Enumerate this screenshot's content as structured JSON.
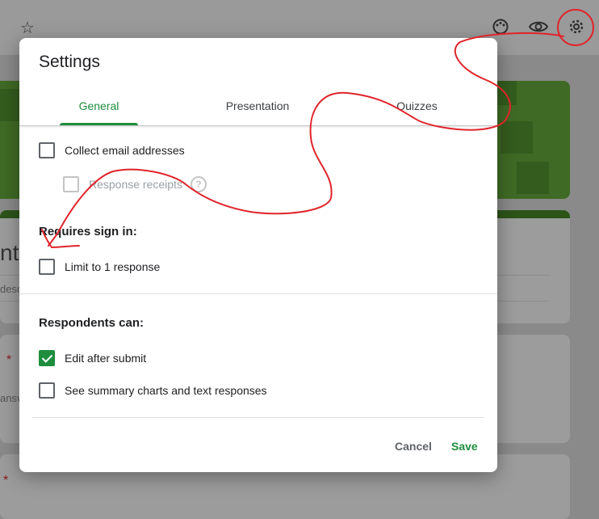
{
  "background": {
    "title_fragment": "nt",
    "description_fragment": "desc",
    "answer_fragment": "ansv",
    "required_mark": "*",
    "icons": [
      "star-icon",
      "palette-icon",
      "eye-icon",
      "gear-icon"
    ]
  },
  "dialog": {
    "title": "Settings",
    "tabs": [
      {
        "label": "General"
      },
      {
        "label": "Presentation"
      },
      {
        "label": "Quizzes"
      }
    ],
    "options": {
      "collect_email": "Collect email addresses",
      "response_receipts": "Response receipts",
      "help_glyph": "?"
    },
    "requires_sign_in": {
      "heading": "Requires sign in:",
      "limit_one": "Limit to 1 response"
    },
    "respondents_can": {
      "heading": "Respondents can:",
      "edit_after_submit": "Edit after submit",
      "edit_after_submit_checked": true,
      "see_summary": "See summary charts and text responses"
    },
    "buttons": {
      "cancel": "Cancel",
      "save": "Save"
    }
  },
  "colors": {
    "accent": "#1e8e3e",
    "annotation": "#e0242a"
  }
}
